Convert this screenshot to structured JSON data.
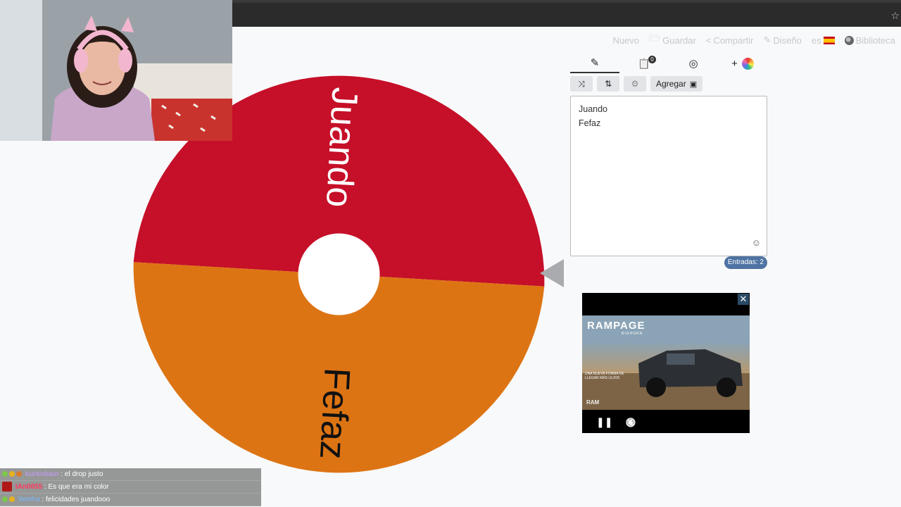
{
  "navbar": {
    "items": [
      {
        "label": "Nuevo",
        "icon": "none"
      },
      {
        "label": "Guardar",
        "icon": "save-icon"
      },
      {
        "label": "Compartir",
        "icon": "share-icon"
      },
      {
        "label": "Diseño",
        "icon": "brush-icon"
      },
      {
        "label": "es",
        "icon": "flag-spain-icon"
      },
      {
        "label": "Biblioteca",
        "icon": "globe-icon"
      }
    ]
  },
  "wheel": {
    "segments": [
      {
        "label": "Juando",
        "color": "#c60f28"
      },
      {
        "label": "Fefaz",
        "color": "#dd7414"
      }
    ],
    "hub_color": "#ffffff",
    "pointer_color": "#a9abae"
  },
  "panel": {
    "tabs": [
      {
        "name": "pencil-icon",
        "glyph": "✎"
      },
      {
        "name": "clipboard-icon",
        "glyph": "📋",
        "badge": "0"
      },
      {
        "name": "eye-slash-icon",
        "glyph": "◎"
      },
      {
        "name": "plus-color-icon",
        "glyph": "+"
      }
    ],
    "toolbar": {
      "shuffle_glyph": "⤨",
      "sort_glyph": "⇅",
      "settings_glyph": "⚙",
      "add_label": "Agregar",
      "add_icon_glyph": "▣"
    },
    "entries": [
      "Juando",
      "Fefaz"
    ],
    "emoji_glyph": "☺",
    "count_label": "Entradas: 2"
  },
  "ad": {
    "title": "RAMPAGE",
    "subtitle": "BIGHORN",
    "copy": "UNA NUEVA FORMA DE LLEGAR MÁS LEJOS",
    "brand": "RAM",
    "close_glyph": "✕",
    "pause_glyph": "❚❚",
    "mute_glyph": "🔇"
  },
  "chat": [
    {
      "user": "kurkobain",
      "message": ": el drop justo",
      "user_color": "#9b7fc9"
    },
    {
      "user": "IAn0055",
      "message": ": Es que era mi color",
      "user_color": "#e0204a"
    },
    {
      "user": "Vonfra",
      "message": ": felicidades juandooo",
      "user_color": "#6aa0d8"
    }
  ],
  "colors": {
    "accent_badge": "#4e73a3",
    "topbar": "#2b2b2b"
  }
}
